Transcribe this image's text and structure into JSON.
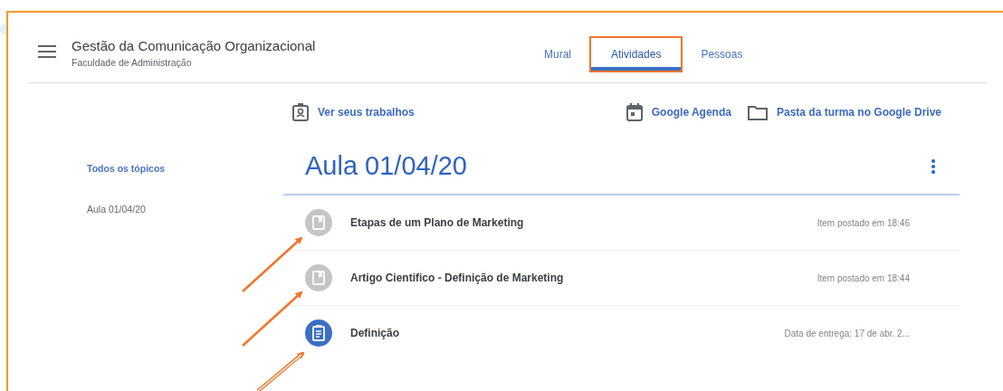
{
  "header": {
    "title": "Gestão da Comunicação Organizacional",
    "subtitle": "Faculdade de Administração"
  },
  "tabs": [
    {
      "label": "Mural",
      "selected": false,
      "highlighted": false
    },
    {
      "label": "Atividades",
      "selected": true,
      "highlighted": true
    },
    {
      "label": "Pessoas",
      "selected": false,
      "highlighted": false
    }
  ],
  "toolbar": {
    "left": {
      "label": "Ver seus trabalhos"
    },
    "right": [
      {
        "label": "Google Agenda",
        "kind": "calendar"
      },
      {
        "label": "Pasta da turma no Google Drive",
        "kind": "folder"
      }
    ]
  },
  "sidebar": {
    "items": [
      {
        "label": "Todos os tópicos",
        "selected": true
      },
      {
        "label": "Aula 01/04/20",
        "selected": false
      }
    ]
  },
  "topic": {
    "title": "Aula 01/04/20"
  },
  "items": [
    {
      "kind": "material",
      "title": "Etapas de um Plano de Marketing",
      "meta": "Item postado em 18:46"
    },
    {
      "kind": "material",
      "title": "Artigo Cientifico - Definição de Marketing",
      "meta": "Item postado em 18:44"
    },
    {
      "kind": "assignment",
      "title": "Definição",
      "meta": "Data de entrega: 17 de abr. 2..."
    }
  ]
}
